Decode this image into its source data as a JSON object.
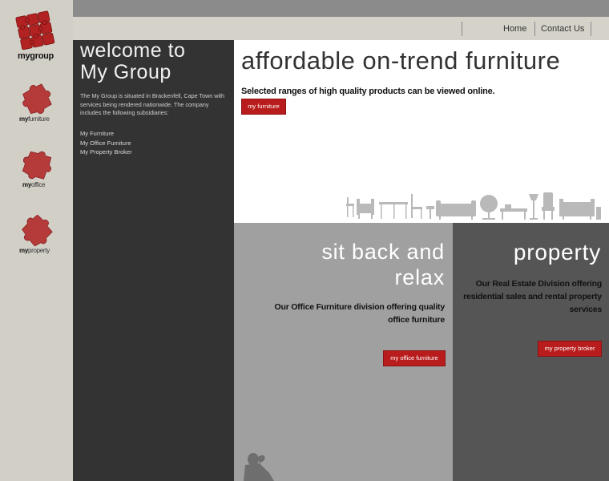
{
  "brand": {
    "logo_word": "mygroup"
  },
  "sidebar": {
    "items": [
      {
        "prefix": "my",
        "name": "furniture",
        "icon": "puzzle-piece-icon"
      },
      {
        "prefix": "my",
        "name": "office",
        "icon": "puzzle-piece-icon"
      },
      {
        "prefix": "my",
        "name": "property",
        "icon": "puzzle-piece-icon"
      }
    ]
  },
  "nav": {
    "home": "Home",
    "contact": "Contact Us"
  },
  "welcome": {
    "title_line1": "welcome to",
    "title_line2": "My Group",
    "intro": "The My Group is situated in Brackenfell, Cape Town with services being rendered nationwide. The company includes the following subsidiaries:",
    "links": [
      "My Furniture",
      "My Office Furniture",
      "My Property Broker"
    ]
  },
  "hero": {
    "title": "affordable on-trend furniture",
    "tagline": "Selected ranges of high quality products can be viewed online.",
    "button": "my furniture"
  },
  "office": {
    "title_line1": "sit back and",
    "title_line2": "relax",
    "description": "Our Office Furniture division offering quality office furniture",
    "button": "my office furniture"
  },
  "property": {
    "title": "property",
    "description": "Our Real Estate Division offering residential sales and rental property services",
    "button": "my property broker"
  },
  "colors": {
    "accent_red": "#b81c1c",
    "dark_panel": "#333333",
    "mid_panel": "#a0a0a0",
    "property_panel": "#555555",
    "topbar": "#8b8b8b"
  }
}
